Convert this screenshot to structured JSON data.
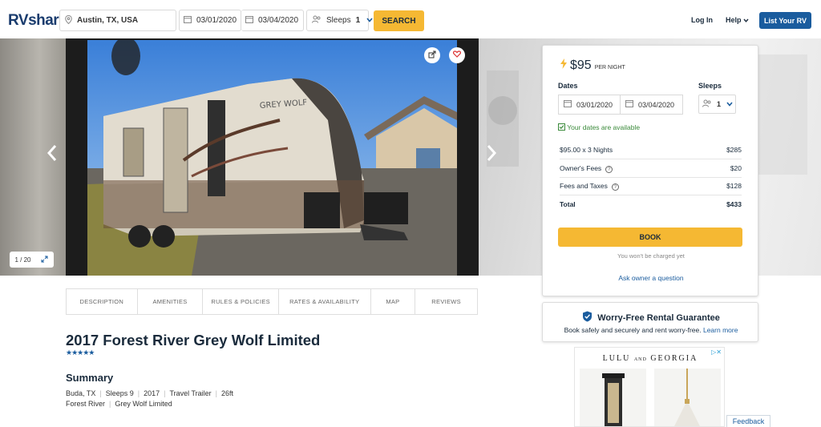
{
  "nav": {
    "logo_rv": "RV",
    "logo_share": "share",
    "location": "Austin, TX, USA",
    "start_date": "03/01/2020",
    "end_date": "03/04/2020",
    "sleeps_label": "Sleeps",
    "sleeps_value": "1",
    "search_label": "SEARCH",
    "login_label": "Log In",
    "help_label": "Help",
    "list_rv_label": "List Your RV"
  },
  "gallery": {
    "counter": "1 / 20"
  },
  "tabs": [
    "DESCRIPTION",
    "AMENITIES",
    "RULES & POLICIES",
    "RATES & AVAILABILITY",
    "MAP",
    "REVIEWS"
  ],
  "listing": {
    "title": "2017 Forest River Grey Wolf Limited",
    "stars": "★★★★★",
    "rating": 5,
    "summary_heading": "Summary",
    "facts_line1": [
      "Buda, TX",
      "Sleeps 9",
      "2017",
      "Travel Trailer",
      "26ft"
    ],
    "facts_line2": [
      "Forest River",
      "Grey Wolf Limited"
    ]
  },
  "booking": {
    "price": "$95",
    "per_night": "PER NIGHT",
    "dates_label": "Dates",
    "sleeps_label": "Sleeps",
    "start_date": "03/01/2020",
    "end_date": "03/04/2020",
    "sleeps_value": "1",
    "availability": "Your dates are available",
    "lines": [
      {
        "label": "$95.00 x 3 Nights",
        "amount": "$285"
      },
      {
        "label": "Owner's Fees",
        "amount": "$20"
      },
      {
        "label": "Fees and Taxes",
        "amount": "$128"
      },
      {
        "label": "Total",
        "amount": "$433"
      }
    ],
    "book_label": "BOOK",
    "no_charge": "You won't be charged yet",
    "ask_owner": "Ask owner a question"
  },
  "guarantee": {
    "title": "Worry-Free Rental Guarantee",
    "text": "Book safely and securely and rent worry-free.",
    "link": "Learn more"
  },
  "ad": {
    "brand_left": "LULU",
    "brand_and": "AND",
    "brand_right": "GEORGIA"
  },
  "feedback_label": "Feedback",
  "colors": {
    "brand_blue": "#1a5c9e",
    "accent_yellow": "#f5b833",
    "available_green": "#3a8a3a"
  }
}
